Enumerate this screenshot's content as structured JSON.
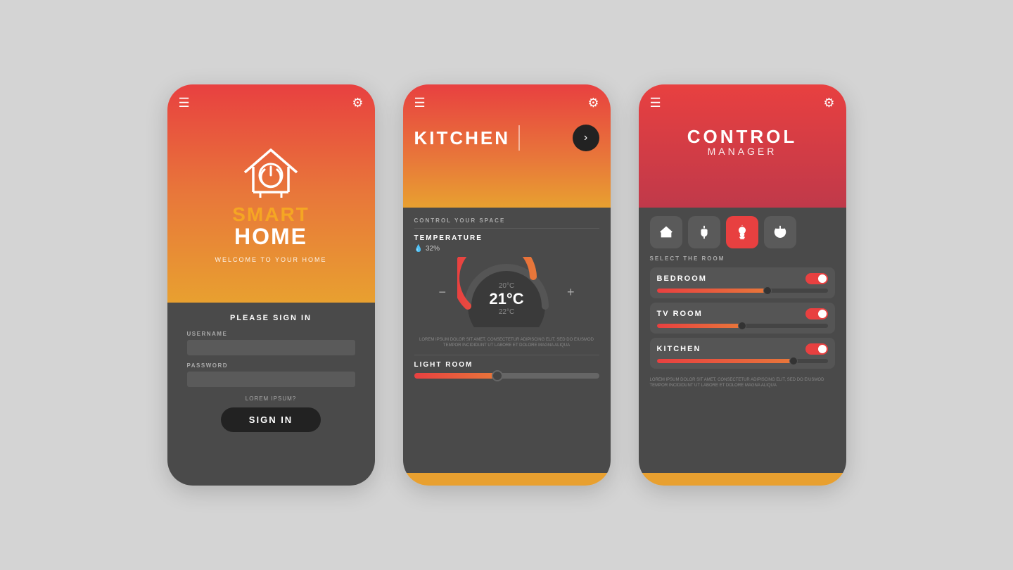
{
  "background": "#d4d4d4",
  "phone1": {
    "title_smart": "SMART",
    "title_home": "HOME",
    "welcome": "WELCOME TO YOUR HOME",
    "sign_in_label": "PLEASE SIGN IN",
    "username_label": "USERNAME",
    "password_label": "PASSWORD",
    "lorem": "LOREM IPSUM?",
    "sign_in_btn": "SIGN IN"
  },
  "phone2": {
    "title": "KITCHEN",
    "control_label": "CONTROL YOUR SPACE",
    "temp_title": "TEMPERATURE",
    "humidity": "32%",
    "temp_top": "20°C",
    "temp_main": "21°C",
    "temp_bottom": "22°C",
    "light_room_title": "LIGHT ROOM",
    "tiny_desc": "LOREM IPSUM DOLOR SIT AMET, CONSECTETUR ADIPISCING ELIT, SED DO EIUSMOD TEMPOR INCIDIDUNT UT LABORE ET DOLORE MAGNA ALIQUA",
    "slider_fill_pct": 45
  },
  "phone3": {
    "title_control": "CONTROL",
    "title_manager": "MANAGER",
    "select_room_label": "SELECT THE ROOM",
    "rooms": [
      {
        "name": "BEDROOM",
        "fill_pct": 65,
        "thumb_pct": 65,
        "on": true
      },
      {
        "name": "TV ROOM",
        "fill_pct": 50,
        "thumb_pct": 50,
        "on": true
      },
      {
        "name": "KITCHEN",
        "fill_pct": 80,
        "thumb_pct": 80,
        "on": true
      }
    ],
    "tiny_desc": "LOREM IPSUM DOLOR SIT AMET, CONSECTETUR ADIPISCING ELIT, SED DO EIUSMOD TEMPOR INCIDIDUNT UT LABORE ET DOLORE MAGNA ALIQUA",
    "icons": [
      "home",
      "plug",
      "bulb",
      "power"
    ]
  }
}
